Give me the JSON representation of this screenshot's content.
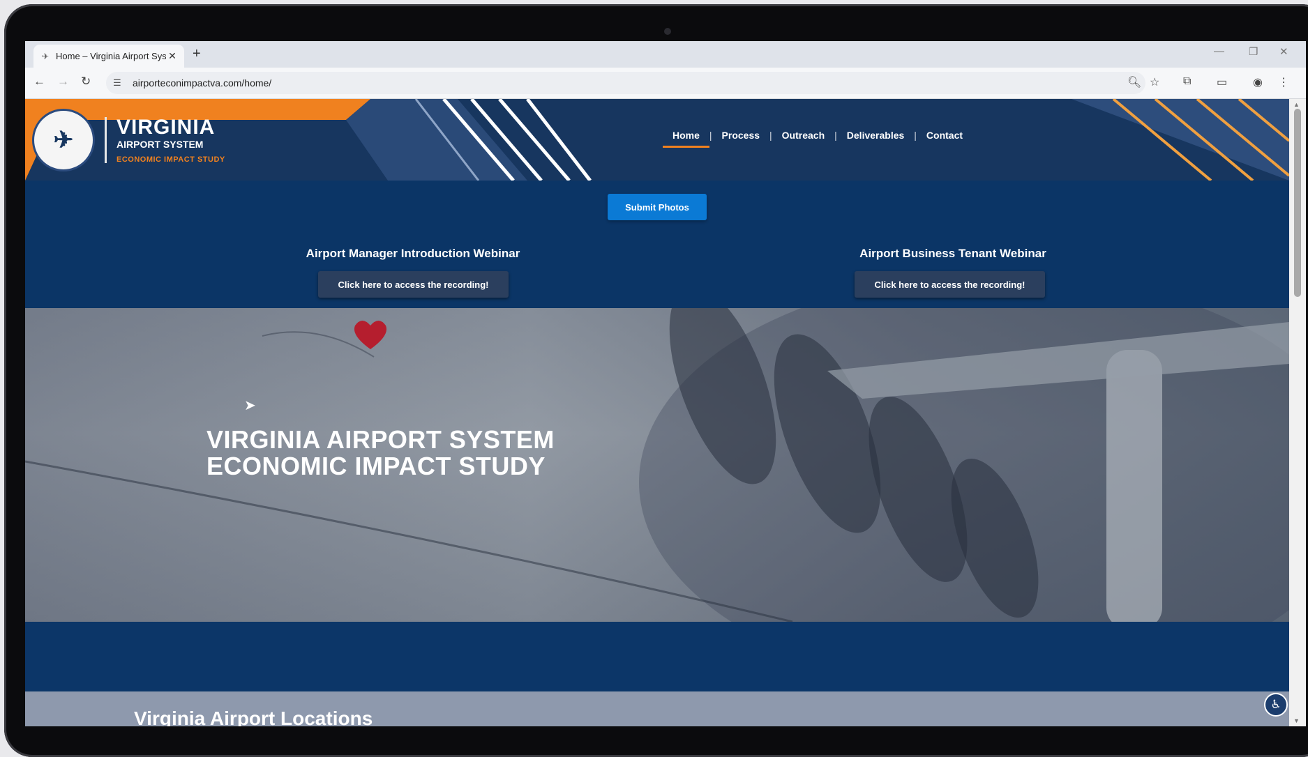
{
  "browser": {
    "tab_title": "Home – Virginia Airport System",
    "url": "airporteconimpactva.com/home/",
    "icons": {
      "back": "arrow-left-icon",
      "forward": "arrow-right-icon",
      "reload": "reload-icon",
      "site_info": "tune-icon",
      "zoom": "zoom-icon",
      "bookmark": "star-icon",
      "extensions": "puzzle-icon",
      "profile": "profile-icon",
      "menu": "kebab-menu-icon"
    }
  },
  "site": {
    "brand_line1": "VIRGINIA",
    "brand_line2": "AIRPORT SYSTEM",
    "brand_line3": "ECONOMIC IMPACT STUDY",
    "nav": [
      "Home",
      "Process",
      "Outreach",
      "Deliverables",
      "Contact"
    ],
    "submit_label": "Submit Photos",
    "webinars": [
      {
        "title": "Airport Manager Introduction Webinar",
        "button": "Click here to access the recording!"
      },
      {
        "title": "Airport Business Tenant Webinar",
        "button": "Click here to access the recording!"
      }
    ],
    "hero_line1": "VIRGINIA AIRPORT SYSTEM",
    "hero_line2": "ECONOMIC IMPACT STUDY",
    "locations_title": "Virginia Airport Locations"
  },
  "colors": {
    "navy": "#0b3566",
    "orange": "#f0811f",
    "button_blue": "#0b7ad5"
  }
}
